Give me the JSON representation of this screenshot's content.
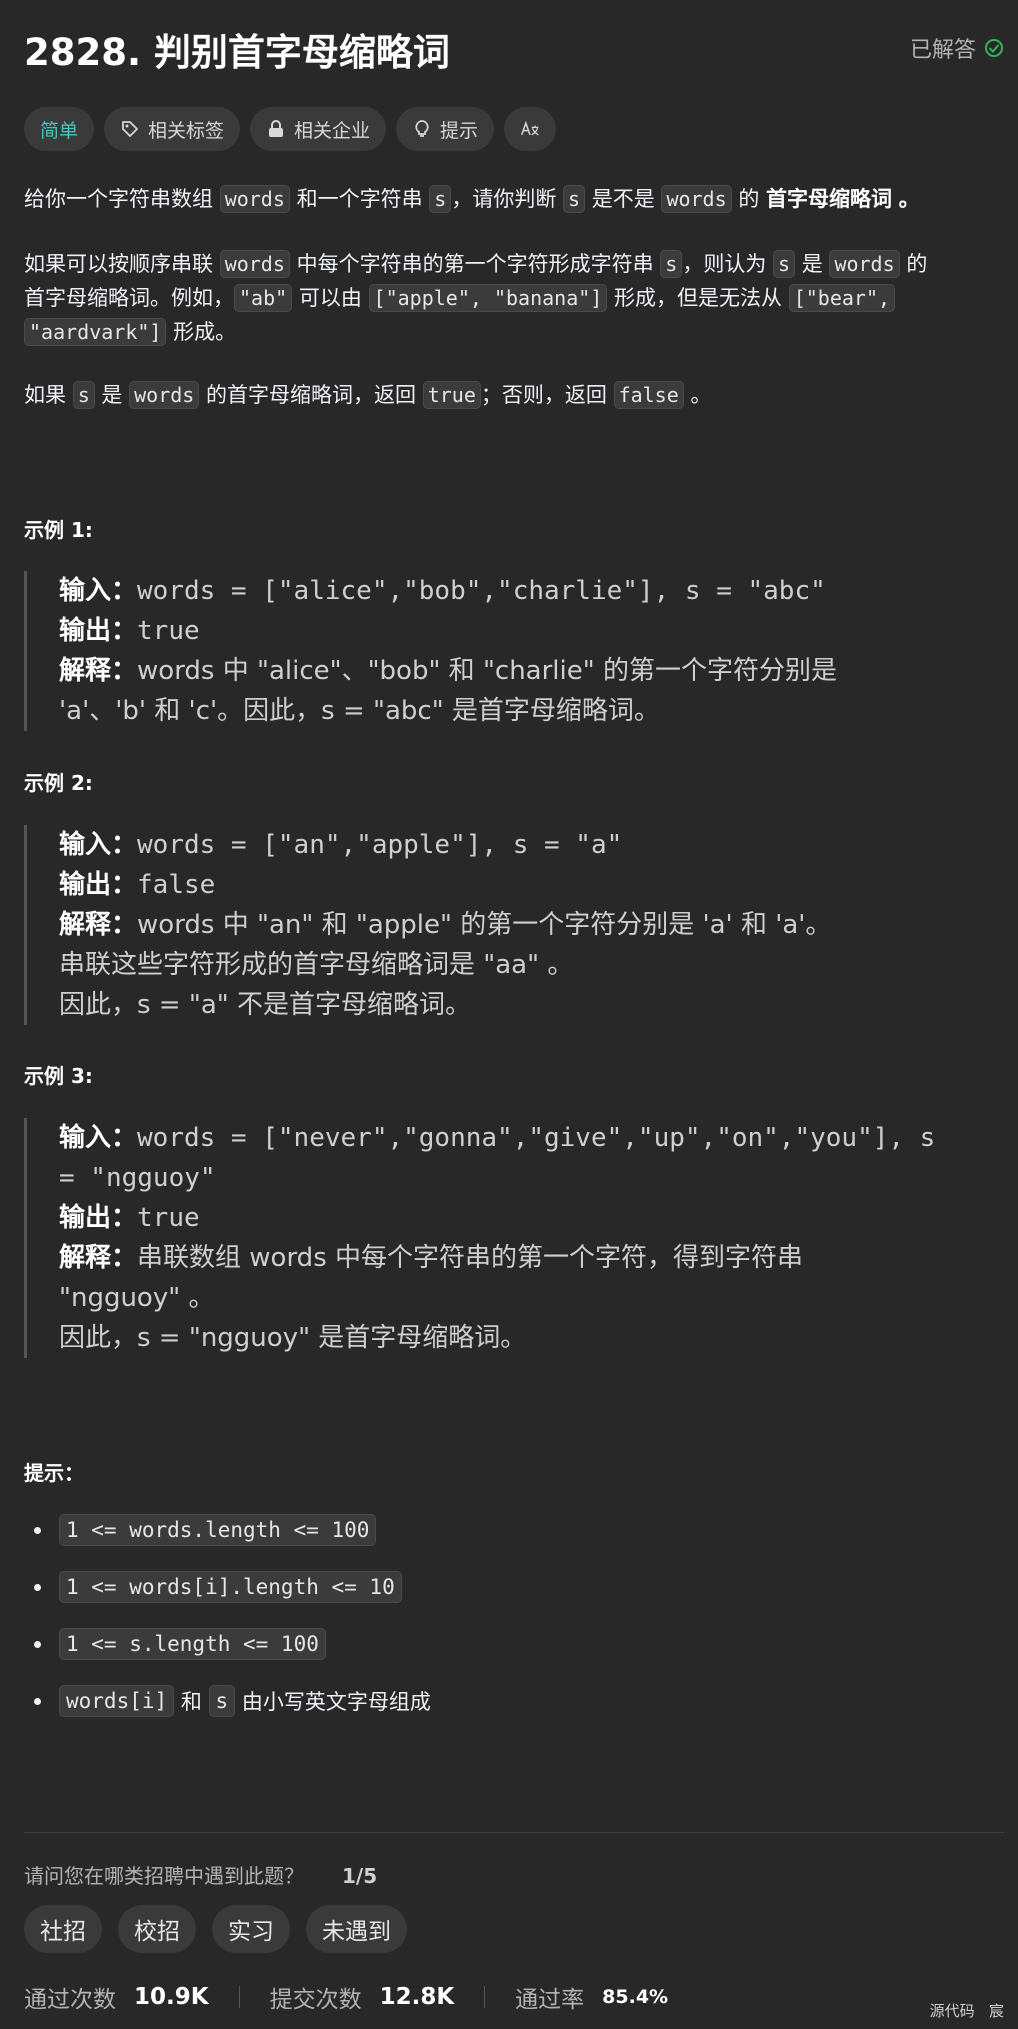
{
  "problem": {
    "title": "2828. 判别首字母缩略词",
    "status": "已解答"
  },
  "tags": {
    "difficulty": "简单",
    "related_tags": "相关标签",
    "related_companies": "相关企业",
    "hint": "提示"
  },
  "description": {
    "p1": {
      "t1": "给你一个字符串数组",
      "c1": "words",
      "t2": "和一个字符串",
      "c2": "s",
      "t3": "，请你判断",
      "c3": "s",
      "t4": "是不是",
      "c4": "words",
      "t5": "的",
      "b1": "首字母缩略词",
      "t6": "。"
    },
    "p2": {
      "t1": "如果可以按顺序串联",
      "c1": "words",
      "t2": "中每个字符串的第一个字符形成字符串",
      "c2": "s",
      "t3": "，则认为",
      "c3": "s",
      "t4": "是",
      "c4": "words",
      "t5": "的",
      "t6": "首字母缩略词。例如，",
      "c5": "\"ab\"",
      "t7": "可以由",
      "c6": "[\"apple\", \"banana\"]",
      "t8": "形成，但是无法从",
      "c7": "[\"bear\",",
      "c8": "\"aardvark\"]",
      "t9": "形成。"
    },
    "p3": {
      "t1": "如果",
      "c1": "s",
      "t2": "是",
      "c2": "words",
      "t3": "的首字母缩略词，返回",
      "c3": "true",
      "t4": "；否则，返回",
      "c4": "false",
      "t5": "。"
    }
  },
  "examples": [
    {
      "title": "示例 1:",
      "input_label": "输入：",
      "input": "words = [\"alice\",\"bob\",\"charlie\"], s = \"abc\"",
      "output_label": "输出：",
      "output": "true",
      "explain_label": "解释：",
      "explain_line1": "words 中 \"alice\"、\"bob\" 和 \"charlie\" 的第一个字符分别是",
      "explain_line2": "'a'、'b' 和 'c'。因此，s = \"abc\" 是首字母缩略词。"
    },
    {
      "title": "示例 2:",
      "input_label": "输入：",
      "input": "words = [\"an\",\"apple\"], s = \"a\"",
      "output_label": "输出：",
      "output": "false",
      "explain_label": "解释：",
      "explain_line1": "words 中 \"an\" 和 \"apple\" 的第一个字符分别是 'a' 和 'a'。",
      "explain_line2": "串联这些字符形成的首字母缩略词是 \"aa\" 。",
      "explain_line3": "因此，s = \"a\" 不是首字母缩略词。"
    },
    {
      "title": "示例 3:",
      "input_label": "输入：",
      "input_line1": "words = [\"never\",\"gonna\",\"give\",\"up\",\"on\",\"you\"], s",
      "input_line2": "= \"ngguoy\"",
      "output_label": "输出：",
      "output": "true",
      "explain_label": "解释：",
      "explain_line1": "串联数组 words 中每个字符串的第一个字符，得到字符串",
      "explain_line2": "\"ngguoy\" 。",
      "explain_line3": "因此，s = \"ngguoy\" 是首字母缩略词。"
    }
  ],
  "constraints": {
    "title": "提示：",
    "items": [
      "1 <= words.length <= 100",
      "1 <= words[i].length <= 10",
      "1 <= s.length <= 100"
    ],
    "last": {
      "c1": "words[i]",
      "t1": "和",
      "c2": "s",
      "t2": "由小写英文字母组成"
    }
  },
  "survey": {
    "question": "请问您在哪类招聘中遇到此题？",
    "page": "1/5",
    "options": [
      "社招",
      "校招",
      "实习",
      "未遇到"
    ]
  },
  "stats": {
    "accepted_label": "通过次数",
    "accepted": "10.9K",
    "submitted_label": "提交次数",
    "submitted": "12.8K",
    "rate_label": "通过率",
    "rate": "85.4%"
  },
  "footer": {
    "source": "源代码",
    "tail": "宸"
  },
  "colors": {
    "accent": "#46c6c2",
    "solved_check": "#2db55d",
    "background": "#282828"
  }
}
